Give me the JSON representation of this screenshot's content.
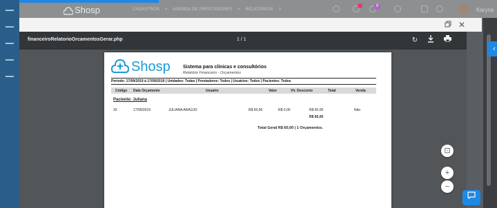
{
  "app": {
    "brand": "Shosp",
    "menu": [
      "CADASTROS",
      ">",
      "AGENDA DE PRESTADORES",
      ">",
      "RELATÓRIOS",
      ">"
    ],
    "user_name": "Karyna",
    "notification_badge": "9"
  },
  "modal": {
    "restore_icon": "restore-icon",
    "close_icon": "close-icon"
  },
  "viewer": {
    "filename": "financeiroRelatorioOrcamentosGerar.php",
    "page_indicator": "1 / 1"
  },
  "report": {
    "brand": "Shosp",
    "title": "Sistema para clínicas e consultórios",
    "subtitle": "Relatório Financeiro - Orçamentos",
    "filter": "Período: 17/09/2019 à 17/09/2019 | Unidades: Todas | Prestadores: Todos | Usuários: Todos | Pacientes: Todos",
    "columns": [
      "Código",
      "Data Orçamento",
      "Usuário",
      "Valor",
      "Vlr. Desconto",
      "Total",
      "Venda"
    ],
    "group_label": "Paciente: Juliana",
    "row": {
      "codigo": "33",
      "data": "17/09/2019",
      "usuario": "JULIANA ARAÚJO",
      "valor": "R$ 60,00",
      "desconto": "R$ 0,00",
      "total": "R$ 60,00",
      "venda": "Não"
    },
    "subtotal": "R$ 60,00",
    "grand_total": "Total Geral R$ 60,00 | 1 Orçamentos."
  },
  "colors": {
    "accent": "#1e88e5",
    "brand": "#1a9bd7",
    "viewer_bar": "#323639",
    "viewer_bg": "#525659"
  }
}
